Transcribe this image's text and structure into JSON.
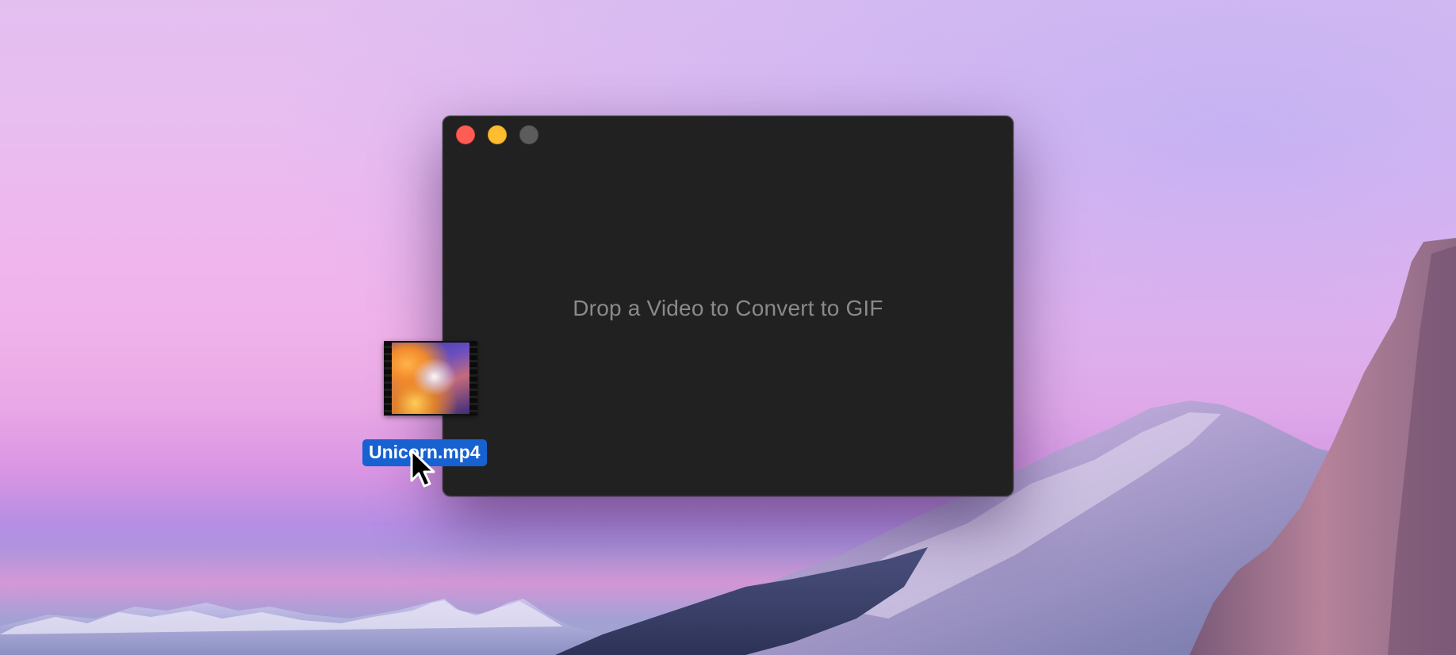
{
  "window": {
    "drop_prompt": "Drop a Video to Convert to GIF",
    "traffic_lights": {
      "close_color": "#fd5d55",
      "minimize_color": "#fdbd2e",
      "zoom_color": "#5c5c5c"
    },
    "background_color": "#212121"
  },
  "dragged_file": {
    "name": "Unicorn.mp4",
    "icon": "video-file-icon",
    "label_color": "#1761d1"
  },
  "cursor": {
    "icon": "arrow-cursor-icon"
  }
}
